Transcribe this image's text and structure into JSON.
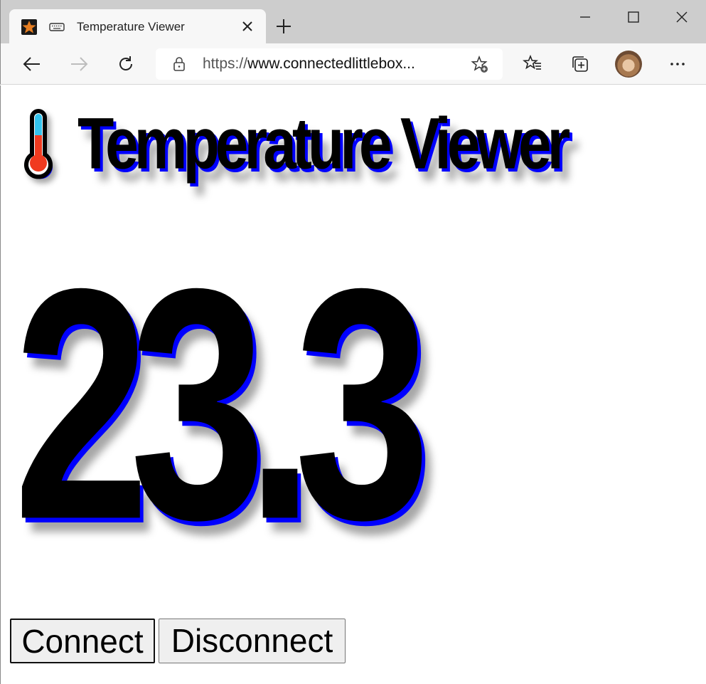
{
  "browser": {
    "tab": {
      "title": "Temperature Viewer",
      "favicon": "star-icon"
    },
    "address_bar": {
      "protocol": "https://",
      "host": "www.connectedlittlebox..."
    },
    "window_controls": [
      "minimize-icon",
      "maximize-icon",
      "close-icon"
    ],
    "toolbar_icons": [
      "back-icon",
      "forward-icon",
      "refresh-icon",
      "lock-icon",
      "add-favorite-icon",
      "favorites-icon",
      "collections-icon",
      "profile-avatar",
      "more-icon"
    ]
  },
  "page": {
    "title": "Temperature Viewer",
    "temperature": "23.3",
    "buttons": {
      "connect": "Connect",
      "disconnect": "Disconnect"
    }
  },
  "colors": {
    "text_shadow": "#0000ff",
    "thermometer_top": "#33c4ee",
    "thermometer_bottom": "#f03a1f",
    "favicon_star": "#e67e22"
  }
}
